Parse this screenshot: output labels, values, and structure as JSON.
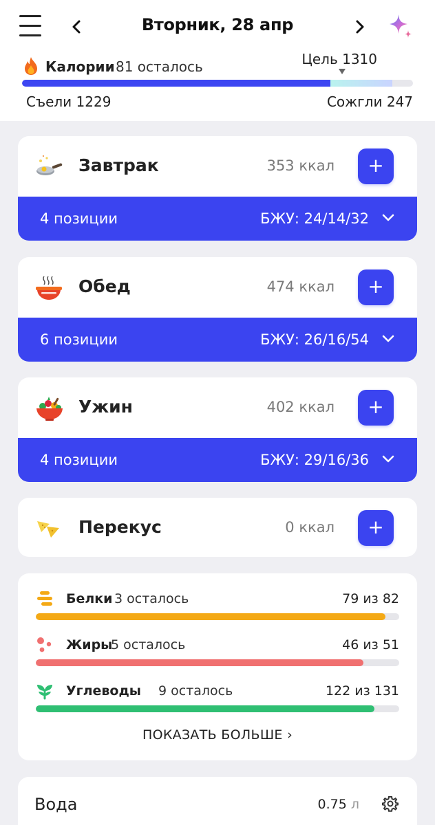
{
  "header": {
    "date": "Вторник, 28 апр"
  },
  "calories": {
    "label": "Калории",
    "remaining_text": "81 осталось",
    "goal_text": "Цель 1310",
    "eaten_text": "Съели 1229",
    "burned_text": "Сожгли 247",
    "goal": 1310,
    "eaten": 1229,
    "burned": 247,
    "colors": {
      "eaten": "#3d46f2",
      "track": "#e7e7ec"
    }
  },
  "meals": [
    {
      "name": "Завтрак",
      "kcal": "353 ккал",
      "count": "4 позиции",
      "macros": "БЖУ: 24/14/32",
      "add": "+",
      "icon": "frying-pan-icon"
    },
    {
      "name": "Обед",
      "kcal": "474 ккал",
      "count": "6 позиции",
      "macros": "БЖУ: 26/16/54",
      "add": "+",
      "icon": "soup-bowl-icon"
    },
    {
      "name": "Ужин",
      "kcal": "402 ккал",
      "count": "4 позиции",
      "macros": "БЖУ: 29/16/36",
      "add": "+",
      "icon": "salad-bowl-icon"
    },
    {
      "name": "Перекус",
      "kcal": "0 ккал",
      "add": "+",
      "icon": "nachos-icon"
    }
  ],
  "macros": {
    "items": [
      {
        "name": "Белки",
        "remaining": "3 осталось",
        "value": "79 из 82",
        "fraction": 0.963,
        "color": "#f4a915",
        "icon": "protein-bars-icon"
      },
      {
        "name": "Жиры",
        "remaining": "5 осталось",
        "value": "46 из 51",
        "fraction": 0.902,
        "color": "#f07070",
        "icon": "fat-drops-icon"
      },
      {
        "name": "Углеводы",
        "remaining": "9 осталось",
        "value": "122 из 131",
        "fraction": 0.931,
        "color": "#2fbf73",
        "icon": "sprout-icon"
      }
    ],
    "show_more": "ПОКАЗАТЬ БОЛЬШЕ ›"
  },
  "water": {
    "title": "Вода",
    "value": "0.75",
    "unit": "л"
  },
  "accent": "#3b44f0"
}
